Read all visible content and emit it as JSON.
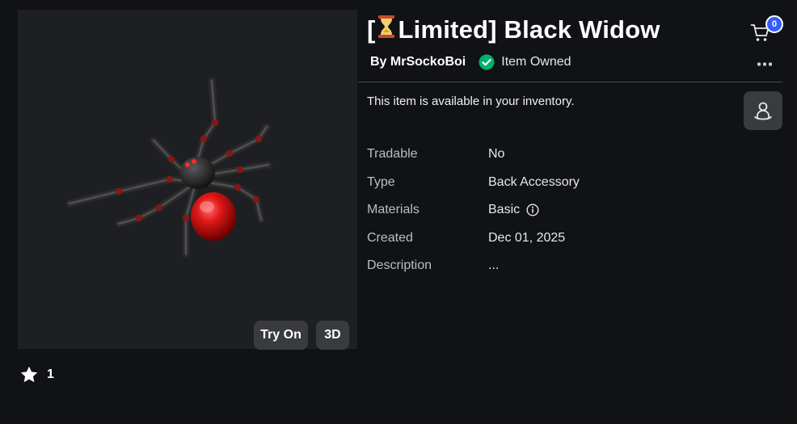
{
  "item": {
    "title_prefix": "[",
    "title_main": "Limited] Black Widow",
    "creator": "By MrSockoBoi",
    "owned_label": "Item Owned",
    "availability": "This item is available in your inventory."
  },
  "cart": {
    "count": "0"
  },
  "preview": {
    "try_on_label": "Try On",
    "three_d_label": "3D"
  },
  "favorites": {
    "count": "1"
  },
  "details": [
    {
      "label": "Tradable",
      "value": "No"
    },
    {
      "label": "Type",
      "value": "Back Accessory"
    },
    {
      "label": "Materials",
      "value": "Basic"
    },
    {
      "label": "Created",
      "value": "Dec 01, 2025"
    },
    {
      "label": "Description",
      "value": "..."
    }
  ],
  "icons": {
    "hourglass": "hourglass-icon",
    "owned": "check-circle-icon",
    "cart": "cart-icon",
    "more": "more-dots-icon",
    "info": "info-icon",
    "side": "avatar-icon",
    "star": "star-icon"
  },
  "colors": {
    "background": "#111216",
    "panel": "#1d1f23",
    "button": "#393b3f",
    "owned_green": "#00b06f",
    "badge_blue": "#335fff"
  }
}
